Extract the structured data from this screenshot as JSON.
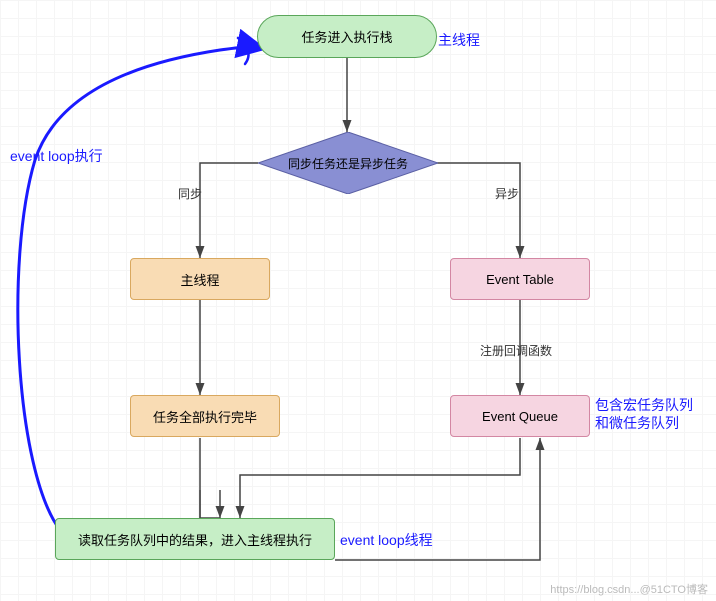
{
  "diagram": {
    "nodes": {
      "start": "任务进入执行栈",
      "decision": "同步任务还是异步任务",
      "main_thread": "主线程",
      "all_done": "任务全部执行完毕",
      "event_table": "Event Table",
      "event_queue": "Event Queue",
      "read_queue": "读取任务队列中的结果，进入主线程执行"
    },
    "edge_labels": {
      "sync": "同步",
      "async": "异步",
      "register_cb": "注册回调函数"
    },
    "annotations": {
      "main_thread_note": "主线程",
      "event_loop_exec": "event loop执行",
      "event_loop_thread": "event loop线程",
      "queue_note": "包含宏任务队列和微任务队列"
    },
    "watermark": "https://blog.csdn...@51CTO博客"
  },
  "chart_data": {
    "type": "flowchart",
    "nodes": [
      {
        "id": "start",
        "label": "任务进入执行栈",
        "shape": "rounded",
        "fill": "#c6eec6"
      },
      {
        "id": "decision",
        "label": "同步任务还是异步任务",
        "shape": "diamond",
        "fill": "#898fd3"
      },
      {
        "id": "main_thread",
        "label": "主线程",
        "shape": "rect",
        "fill": "#f9dcb4"
      },
      {
        "id": "all_done",
        "label": "任务全部执行完毕",
        "shape": "rect",
        "fill": "#f9dcb4"
      },
      {
        "id": "event_table",
        "label": "Event Table",
        "shape": "rect",
        "fill": "#f6d5e1"
      },
      {
        "id": "event_queue",
        "label": "Event Queue",
        "shape": "rect",
        "fill": "#f6d5e1"
      },
      {
        "id": "read_queue",
        "label": "读取任务队列中的结果，进入主线程执行",
        "shape": "rect",
        "fill": "#c6eec6"
      }
    ],
    "edges": [
      {
        "from": "start",
        "to": "decision",
        "label": ""
      },
      {
        "from": "decision",
        "to": "main_thread",
        "label": "同步"
      },
      {
        "from": "decision",
        "to": "event_table",
        "label": "异步"
      },
      {
        "from": "main_thread",
        "to": "all_done",
        "label": ""
      },
      {
        "from": "event_table",
        "to": "event_queue",
        "label": "注册回调函数"
      },
      {
        "from": "all_done",
        "to": "read_queue",
        "label": ""
      },
      {
        "from": "event_queue",
        "to": "read_queue",
        "label": ""
      },
      {
        "from": "read_queue",
        "to": "event_queue",
        "label": "",
        "style": "reverse"
      },
      {
        "from": "read_queue",
        "to": "start",
        "label": "event loop执行",
        "style": "hand-drawn"
      }
    ],
    "annotations": [
      {
        "text": "主线程",
        "attached_to": "start",
        "color": "#1a1aff"
      },
      {
        "text": "event loop执行",
        "attached_to": "loop-back",
        "color": "#1a1aff"
      },
      {
        "text": "event loop线程",
        "attached_to": "read_queue",
        "color": "#1a1aff"
      },
      {
        "text": "包含宏任务队列和微任务队列",
        "attached_to": "event_queue",
        "color": "#1a1aff"
      }
    ]
  }
}
